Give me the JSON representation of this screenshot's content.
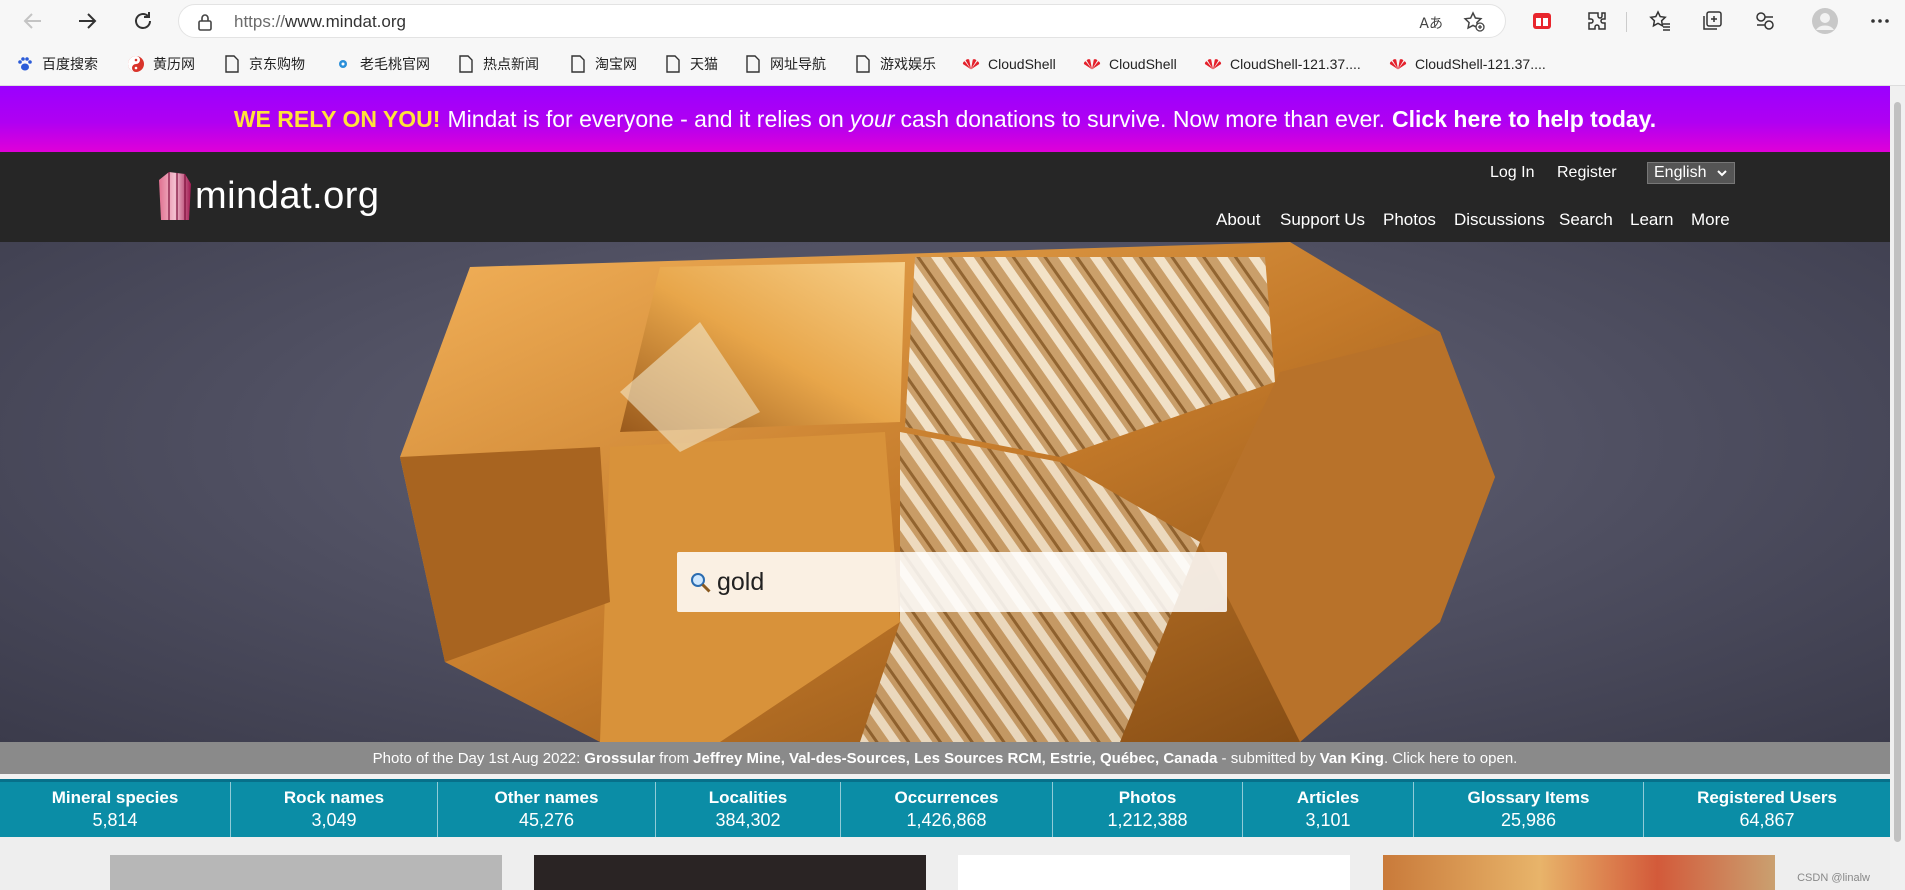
{
  "browser": {
    "url_scheme": "https://",
    "url_host": "www.mindat.org",
    "read_aloud": "Aあ"
  },
  "bookmarks": [
    {
      "label": "百度搜索",
      "icon": "paw-icon"
    },
    {
      "label": "黄历网",
      "icon": "yin-yang-icon"
    },
    {
      "label": "京东购物",
      "icon": "page-icon"
    },
    {
      "label": "老毛桃官网",
      "icon": "dot-icon"
    },
    {
      "label": "热点新闻",
      "icon": "page-icon"
    },
    {
      "label": "淘宝网",
      "icon": "page-icon"
    },
    {
      "label": "天猫",
      "icon": "page-icon"
    },
    {
      "label": "网址导航",
      "icon": "page-icon"
    },
    {
      "label": "游戏娱乐",
      "icon": "page-icon"
    },
    {
      "label": "CloudShell",
      "icon": "huawei-icon"
    },
    {
      "label": "CloudShell",
      "icon": "huawei-icon"
    },
    {
      "label": "CloudShell-121.37....",
      "icon": "huawei-icon"
    },
    {
      "label": "CloudShell-121.37....",
      "icon": "huawei-icon"
    }
  ],
  "banner": {
    "rely": "WE RELY ON YOU!",
    "text_before": "Mindat is for everyone - and it relies on",
    "text_em": "your",
    "text_after": "cash donations to survive. Now more than ever.",
    "cta": "Click here to help today."
  },
  "header": {
    "logo_text": "mindat.org",
    "login": "Log In",
    "register": "Register",
    "language": "English",
    "menu": [
      "About",
      "Support Us",
      "Photos",
      "Discussions",
      "Search",
      "Learn",
      "More"
    ]
  },
  "search": {
    "value": "gold"
  },
  "potd": {
    "prefix": "Photo of the Day 1st Aug 2022:",
    "mineral": "Grossular",
    "from": "from",
    "locality": "Jeffrey Mine, Val-des-Sources, Les Sources RCM, Estrie, Québec, Canada",
    "submitted": "- submitted by",
    "author": "Van King",
    "suffix": ". Click here to open."
  },
  "stats": [
    {
      "label": "Mineral species",
      "value": "5,814"
    },
    {
      "label": "Rock names",
      "value": "3,049"
    },
    {
      "label": "Other names",
      "value": "45,276"
    },
    {
      "label": "Localities",
      "value": "384,302"
    },
    {
      "label": "Occurrences",
      "value": "1,426,868"
    },
    {
      "label": "Photos",
      "value": "1,212,388"
    },
    {
      "label": "Articles",
      "value": "3,101"
    },
    {
      "label": "Glossary Items",
      "value": "25,986"
    },
    {
      "label": "Registered Users",
      "value": "64,867"
    }
  ],
  "watermark": "CSDN @linalw",
  "colors": {
    "banner_purple": "#9a00ff",
    "banner_yellow": "#ffe23a",
    "header_bg": "#262626",
    "stats_teal": "#0b8da6"
  }
}
